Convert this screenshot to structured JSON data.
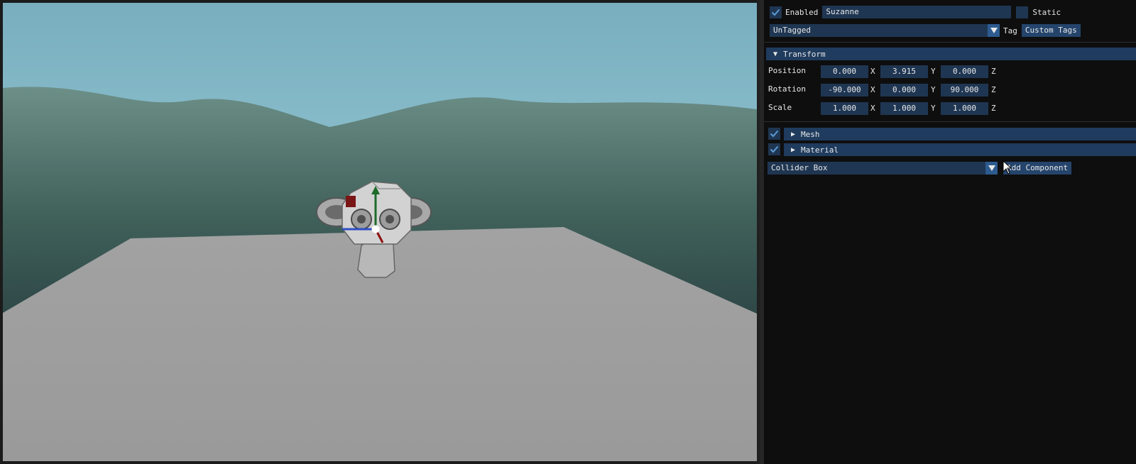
{
  "inspector": {
    "enabled_label": "Enabled",
    "enabled_checked": true,
    "object_name": "Suzanne",
    "static_label": "Static",
    "static_checked": false,
    "tag_value": "UnTagged",
    "tag_label": "Tag",
    "custom_tags_button": "Custom Tags",
    "transform": {
      "header": "Transform",
      "rows": [
        {
          "label": "Position",
          "x": "0.000",
          "y": "3.915",
          "z": "0.000"
        },
        {
          "label": "Rotation",
          "x": "-90.000",
          "y": "0.000",
          "z": "90.000"
        },
        {
          "label": "Scale",
          "x": "1.000",
          "y": "1.000",
          "z": "1.000"
        }
      ],
      "axis_x": "X",
      "axis_y": "Y",
      "axis_z": "Z"
    },
    "components": [
      {
        "name": "Mesh",
        "enabled": true
      },
      {
        "name": "Material",
        "enabled": true
      }
    ],
    "component_select_value": "Collider Box",
    "add_component_button": "Add Component"
  },
  "colors": {
    "field_bg": "#1f3652",
    "header_bg": "#1f3b5e",
    "button_bg": "#24446b",
    "check_color": "#5b9bd5",
    "floor": "#9a9a9a"
  },
  "icons": {
    "checkbox": "checkmark-icon",
    "dropdown": "triangle-down-icon",
    "collapse_open": "triangle-down-icon",
    "collapse_closed": "triangle-right-icon",
    "cursor": "mouse-pointer-icon"
  }
}
